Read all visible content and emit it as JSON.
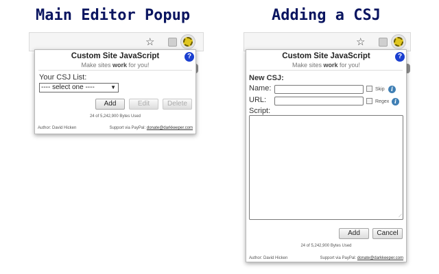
{
  "headings": {
    "left": "Main Editor Popup",
    "right": "Adding a CSJ"
  },
  "icons": {
    "star": "star-icon",
    "extension": "extension-icon",
    "csj": "gear-icon",
    "help": "help-icon",
    "info": "info-icon"
  },
  "colors": {
    "heading": "#0a1560",
    "help_icon": "#1a3fd0",
    "info_icon": "#3f7fb4",
    "gear": "#e1c720"
  },
  "main_popup": {
    "title": "Custom Site JavaScript",
    "tagline_pre": "Make sites ",
    "tagline_bold": "work",
    "tagline_post": " for you!",
    "help_glyph": "?",
    "list_label": "Your CSJ List:",
    "select_value": "---- select one ----",
    "select_arrow": "▼",
    "buttons": {
      "add": "Add",
      "edit": "Edit",
      "delete": "Delete"
    },
    "bytes_used": "24 of 5,242,900 Bytes Used",
    "footer_author": "Author: David Hicken",
    "footer_support": "Support via PayPal: ",
    "footer_email": "donate@darkkeeper.com"
  },
  "add_popup": {
    "title": "Custom Site JavaScript",
    "tagline_pre": "Make sites ",
    "tagline_bold": "work",
    "tagline_post": " for you!",
    "help_glyph": "?",
    "section_label": "New CSJ:",
    "name_label": "Name:",
    "url_label": "URL:",
    "skip_label": "Skip",
    "regex_label": "Regex",
    "info_glyph": "i",
    "script_label": "Script:",
    "grip_glyph": "⟋",
    "buttons": {
      "add": "Add",
      "cancel": "Cancel"
    },
    "bytes_used": "24 of 5,242,900 Bytes Used",
    "footer_author": "Author: David Hicken",
    "footer_support": "Support via PayPal: ",
    "footer_email": "donate@darkkeeper.com"
  },
  "toolbar": {
    "star_glyph": "☆"
  }
}
